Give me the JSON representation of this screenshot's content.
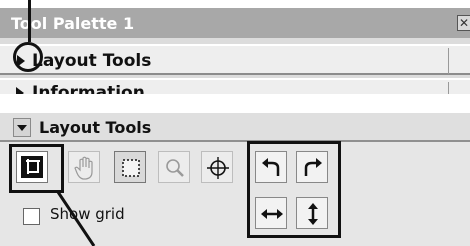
{
  "palette": {
    "title": "Tool Palette 1",
    "close_glyph": "✕",
    "sections": [
      {
        "label": "Layout Tools",
        "icon": "triangle-right-icon"
      },
      {
        "label": "Information",
        "icon": "triangle-right-icon"
      }
    ]
  },
  "panel": {
    "title": "Layout Tools",
    "collapse_icon": "triangle-down-icon",
    "tools": [
      {
        "name": "crop-icon",
        "selected": true
      },
      {
        "name": "hand-icon",
        "selected": false
      },
      {
        "name": "marquee-icon",
        "selected": true
      },
      {
        "name": "zoom-icon",
        "selected": false
      },
      {
        "name": "target-icon",
        "selected": false
      },
      {
        "name": "rotate-left-icon",
        "selected": false
      },
      {
        "name": "rotate-right-icon",
        "selected": false
      },
      {
        "name": "flip-horizontal-icon",
        "selected": false
      },
      {
        "name": "flip-vertical-icon",
        "selected": false
      }
    ],
    "show_grid": {
      "label": "Show grid",
      "checked": false
    }
  }
}
